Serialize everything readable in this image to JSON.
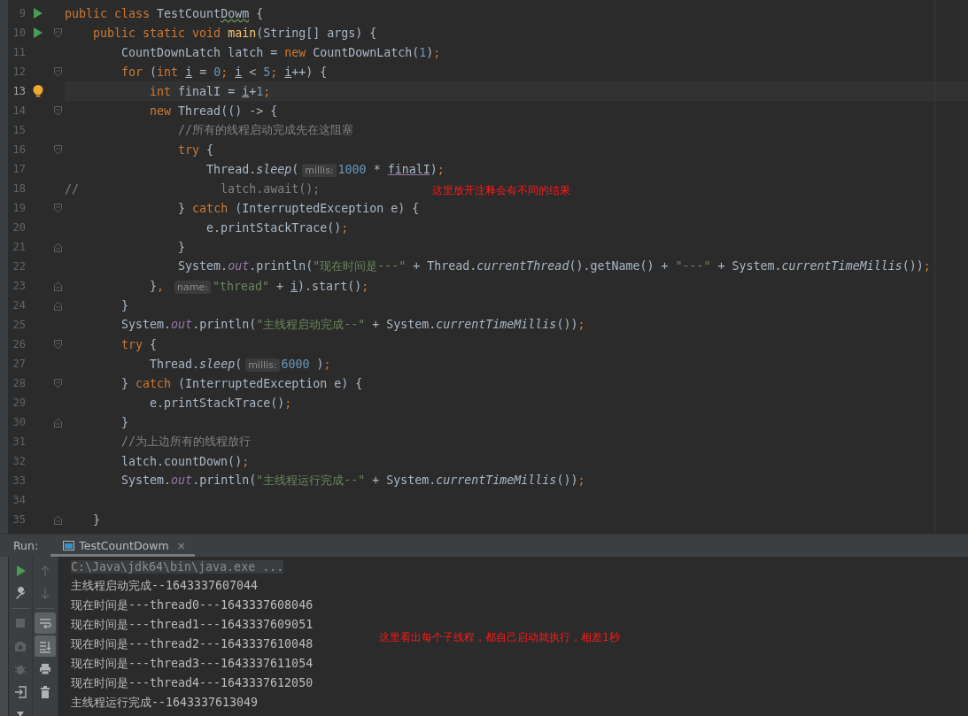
{
  "editor": {
    "lines": [
      {
        "number": "9",
        "gutter": {
          "kind": "run"
        },
        "current": false,
        "tokens": [
          {
            "kind": "kw",
            "t": "public class "
          },
          {
            "kind": "p",
            "t": "TestCount"
          },
          {
            "kind": "typo",
            "t": "Dowm"
          },
          {
            "kind": "p",
            "t": " {"
          }
        ]
      },
      {
        "number": "10",
        "gutter": {
          "kind": "run"
        },
        "fold": {
          "kind": "open"
        },
        "current": false,
        "tokens": [
          {
            "kind": "kw",
            "t": "    public static void "
          },
          {
            "kind": "fn",
            "t": "main"
          },
          {
            "kind": "p",
            "t": "(String[] args) {"
          }
        ]
      },
      {
        "number": "11",
        "current": false,
        "tokens": [
          {
            "kind": "p",
            "t": "        CountDownLatch latch = "
          },
          {
            "kind": "kw",
            "t": "new "
          },
          {
            "kind": "p",
            "t": "CountDownLatch("
          },
          {
            "kind": "num",
            "t": "1"
          },
          {
            "kind": "p",
            "t": ")"
          },
          {
            "kind": "kw",
            "t": ";"
          }
        ]
      },
      {
        "number": "12",
        "fold": {
          "kind": "open"
        },
        "current": false,
        "tokens": [
          {
            "kind": "kw",
            "t": "        for "
          },
          {
            "kind": "p",
            "t": "("
          },
          {
            "kind": "kw",
            "t": "int "
          },
          {
            "kind": "ul",
            "t": "i"
          },
          {
            "kind": "p",
            "t": " = "
          },
          {
            "kind": "num",
            "t": "0"
          },
          {
            "kind": "kw",
            "t": "; "
          },
          {
            "kind": "ul",
            "t": "i"
          },
          {
            "kind": "p",
            "t": " < "
          },
          {
            "kind": "num",
            "t": "5"
          },
          {
            "kind": "kw",
            "t": "; "
          },
          {
            "kind": "ul",
            "t": "i"
          },
          {
            "kind": "p",
            "t": "++) {"
          }
        ]
      },
      {
        "number": "13",
        "gutter": {
          "kind": "bulb"
        },
        "current": true,
        "tokens": [
          {
            "kind": "kw",
            "t": "            int "
          },
          {
            "kind": "p",
            "t": "finalI = "
          },
          {
            "kind": "ul",
            "t": "i"
          },
          {
            "kind": "p",
            "t": "+"
          },
          {
            "kind": "num",
            "t": "1"
          },
          {
            "kind": "kw",
            "t": ";"
          }
        ]
      },
      {
        "number": "14",
        "fold": {
          "kind": "open"
        },
        "current": false,
        "tokens": [
          {
            "kind": "kw",
            "t": "            new "
          },
          {
            "kind": "p",
            "t": "Thread(() -> {"
          }
        ]
      },
      {
        "number": "15",
        "current": false,
        "tokens": [
          {
            "kind": "cm",
            "t": "                //所有的线程启动完成先在这阻塞"
          }
        ]
      },
      {
        "number": "16",
        "fold": {
          "kind": "open"
        },
        "current": false,
        "tokens": [
          {
            "kind": "kw",
            "t": "                try "
          },
          {
            "kind": "p",
            "t": "{"
          }
        ]
      },
      {
        "number": "17",
        "current": false,
        "tokens": [
          {
            "kind": "p",
            "t": "                    Thread."
          },
          {
            "kind": "st",
            "t": "sleep"
          },
          {
            "kind": "p",
            "t": "("
          },
          {
            "kind": "hint",
            "t": "millis:"
          },
          {
            "kind": "num",
            "t": "1000"
          },
          {
            "kind": "p",
            "t": " * "
          },
          {
            "kind": "cap",
            "t": "finalI"
          },
          {
            "kind": "p",
            "t": ")"
          },
          {
            "kind": "kw",
            "t": ";"
          }
        ]
      },
      {
        "number": "18",
        "current": false,
        "tokens": [
          {
            "kind": "cm",
            "t": "//                    latch.await();"
          }
        ]
      },
      {
        "number": "19",
        "fold": {
          "kind": "open"
        },
        "current": false,
        "tokens": [
          {
            "kind": "p",
            "t": "                } "
          },
          {
            "kind": "kw",
            "t": "catch "
          },
          {
            "kind": "p",
            "t": "(InterruptedException e) {"
          }
        ]
      },
      {
        "number": "20",
        "current": false,
        "tokens": [
          {
            "kind": "p",
            "t": "                    e.printStackTrace()"
          },
          {
            "kind": "kw",
            "t": ";"
          }
        ]
      },
      {
        "number": "21",
        "fold": {
          "kind": "close"
        },
        "current": false,
        "tokens": [
          {
            "kind": "p",
            "t": "                }"
          }
        ]
      },
      {
        "number": "22",
        "current": false,
        "tokens": [
          {
            "kind": "p",
            "t": "                System."
          },
          {
            "kind": "fld",
            "t": "out"
          },
          {
            "kind": "p",
            "t": ".println("
          },
          {
            "kind": "str",
            "t": "\"现在时间是---\""
          },
          {
            "kind": "p",
            "t": " + Thread."
          },
          {
            "kind": "st",
            "t": "currentThread"
          },
          {
            "kind": "p",
            "t": "().getName() + "
          },
          {
            "kind": "str",
            "t": "\"---\""
          },
          {
            "kind": "p",
            "t": " + System."
          },
          {
            "kind": "st",
            "t": "currentTimeMillis"
          },
          {
            "kind": "p",
            "t": "())"
          },
          {
            "kind": "kw",
            "t": ";"
          }
        ]
      },
      {
        "number": "23",
        "fold": {
          "kind": "close"
        },
        "current": false,
        "tokens": [
          {
            "kind": "p",
            "t": "            }"
          },
          {
            "kind": "kw",
            "t": ", "
          },
          {
            "kind": "hint",
            "t": "name:"
          },
          {
            "kind": "str",
            "t": "\"thread\""
          },
          {
            "kind": "p",
            "t": " + "
          },
          {
            "kind": "ul",
            "t": "i"
          },
          {
            "kind": "p",
            "t": ").start()"
          },
          {
            "kind": "kw",
            "t": ";"
          }
        ]
      },
      {
        "number": "24",
        "fold": {
          "kind": "close"
        },
        "current": false,
        "tokens": [
          {
            "kind": "p",
            "t": "        }"
          }
        ]
      },
      {
        "number": "25",
        "current": false,
        "tokens": [
          {
            "kind": "p",
            "t": "        System."
          },
          {
            "kind": "fld",
            "t": "out"
          },
          {
            "kind": "p",
            "t": ".println("
          },
          {
            "kind": "str",
            "t": "\"主线程启动完成--\""
          },
          {
            "kind": "p",
            "t": " + System."
          },
          {
            "kind": "st",
            "t": "currentTimeMillis"
          },
          {
            "kind": "p",
            "t": "())"
          },
          {
            "kind": "kw",
            "t": ";"
          }
        ]
      },
      {
        "number": "26",
        "fold": {
          "kind": "open"
        },
        "current": false,
        "tokens": [
          {
            "kind": "kw",
            "t": "        try "
          },
          {
            "kind": "p",
            "t": "{"
          }
        ]
      },
      {
        "number": "27",
        "current": false,
        "tokens": [
          {
            "kind": "p",
            "t": "            Thread."
          },
          {
            "kind": "st",
            "t": "sleep"
          },
          {
            "kind": "p",
            "t": "("
          },
          {
            "kind": "hint",
            "t": "millis:"
          },
          {
            "kind": "num",
            "t": "6000"
          },
          {
            "kind": "p",
            "t": " )"
          },
          {
            "kind": "kw",
            "t": ";"
          }
        ]
      },
      {
        "number": "28",
        "fold": {
          "kind": "open"
        },
        "current": false,
        "tokens": [
          {
            "kind": "p",
            "t": "        } "
          },
          {
            "kind": "kw",
            "t": "catch "
          },
          {
            "kind": "p",
            "t": "(InterruptedException e) {"
          }
        ]
      },
      {
        "number": "29",
        "current": false,
        "tokens": [
          {
            "kind": "p",
            "t": "            e.printStackTrace()"
          },
          {
            "kind": "kw",
            "t": ";"
          }
        ]
      },
      {
        "number": "30",
        "fold": {
          "kind": "close"
        },
        "current": false,
        "tokens": [
          {
            "kind": "p",
            "t": "        }"
          }
        ]
      },
      {
        "number": "31",
        "current": false,
        "tokens": [
          {
            "kind": "cm",
            "t": "        //为上边所有的线程放行"
          }
        ]
      },
      {
        "number": "32",
        "current": false,
        "tokens": [
          {
            "kind": "p",
            "t": "        latch.countDown()"
          },
          {
            "kind": "kw",
            "t": ";"
          }
        ]
      },
      {
        "number": "33",
        "current": false,
        "tokens": [
          {
            "kind": "p",
            "t": "        System."
          },
          {
            "kind": "fld",
            "t": "out"
          },
          {
            "kind": "p",
            "t": ".println("
          },
          {
            "kind": "str",
            "t": "\"主线程运行完成--\""
          },
          {
            "kind": "p",
            "t": " + System."
          },
          {
            "kind": "st",
            "t": "currentTimeMillis"
          },
          {
            "kind": "p",
            "t": "())"
          },
          {
            "kind": "kw",
            "t": ";"
          }
        ]
      },
      {
        "number": "34",
        "current": false
      },
      {
        "number": "35",
        "fold": {
          "kind": "close"
        },
        "current": false,
        "tokens": [
          {
            "kind": "p",
            "t": "    }"
          }
        ]
      }
    ],
    "annotation": "这里放开注释会有不同的结果"
  },
  "run_panel": {
    "label": "Run:",
    "tabs": [
      {
        "title": "TestCountDowm",
        "close": "×",
        "selected": true
      }
    ],
    "left_tools": [
      {
        "kind": "run",
        "disabled": false
      },
      {
        "kind": "wrench",
        "disabled": false
      },
      {
        "kind": "stop",
        "disabled": true
      },
      {
        "kind": "camera",
        "disabled": true
      },
      {
        "kind": "bug",
        "disabled": true
      },
      {
        "kind": "exit",
        "disabled": false
      },
      {
        "kind": "pin",
        "disabled": false
      }
    ],
    "right_tools": [
      {
        "kind": "up",
        "disabled": true,
        "selected": false
      },
      {
        "kind": "down",
        "disabled": true,
        "selected": false
      },
      {
        "kind": "wrap",
        "disabled": false,
        "selected": true
      },
      {
        "kind": "scroll",
        "disabled": false,
        "selected": true
      },
      {
        "kind": "print",
        "disabled": false,
        "selected": false
      },
      {
        "kind": "trash",
        "disabled": false,
        "selected": false
      }
    ],
    "console": [
      {
        "kind": "command",
        "text": "C:\\Java\\jdk64\\bin\\java.exe ..."
      },
      {
        "kind": "output",
        "text": "主线程启动完成--1643337607044"
      },
      {
        "kind": "output",
        "text": "现在时间是---thread0---1643337608046"
      },
      {
        "kind": "output",
        "text": "现在时间是---thread1---1643337609051"
      },
      {
        "kind": "output",
        "text": "现在时间是---thread2---1643337610048"
      },
      {
        "kind": "output",
        "text": "现在时间是---thread3---1643337611054"
      },
      {
        "kind": "output",
        "text": "现在时间是---thread4---1643337612050"
      },
      {
        "kind": "output",
        "text": "主线程运行完成--1643337613049"
      }
    ],
    "annotation": "这里看出每个子线程，都自己启动就执行，相差1秒"
  }
}
